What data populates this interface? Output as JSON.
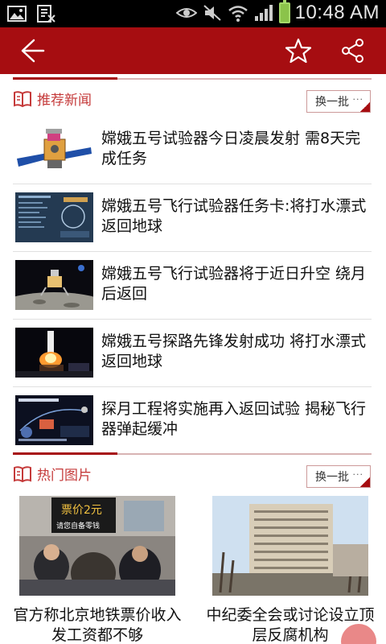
{
  "status_bar": {
    "time": "10:48 AM",
    "icons": [
      "image-icon",
      "reader-icon",
      "eye-icon",
      "mute-icon",
      "wifi-icon",
      "signal-icon",
      "battery-icon"
    ]
  },
  "app_bar": {
    "back_icon": "back-arrow-icon",
    "star_icon": "star-icon",
    "share_icon": "share-icon",
    "background": "#a60d11"
  },
  "recommended": {
    "title": "推荐新闻",
    "refresh_label": "换一批",
    "dots": "···",
    "items": [
      {
        "title": "嫦娥五号试验器今日凌晨发射 需8天完成任务",
        "thumb": "satellite"
      },
      {
        "title": "嫦娥五号飞行试验器任务卡:将打水漂式返回地球",
        "thumb": "screen"
      },
      {
        "title": "嫦娥五号飞行试验器将于近日升空 绕月后返回",
        "thumb": "moon"
      },
      {
        "title": "嫦娥五号探路先锋发射成功 将打水漂式返回地球",
        "thumb": "launch"
      },
      {
        "title": "探月工程将实施再入返回试验 揭秘飞行器弹起缓冲",
        "thumb": "diagram"
      }
    ]
  },
  "hot_pictures": {
    "title": "热门图片",
    "refresh_label": "换一批",
    "dots": "···",
    "items": [
      {
        "caption": "官方称北京地铁票价收入发工资都不够",
        "sign_text": "票价2元",
        "sign_sub": "请您自备零钱"
      },
      {
        "caption": "中纪委全会或讨论设立顶层反腐机构",
        "thumb": "building"
      }
    ]
  },
  "colors": {
    "accent": "#a60d11",
    "section_title": "#c53a3a"
  }
}
